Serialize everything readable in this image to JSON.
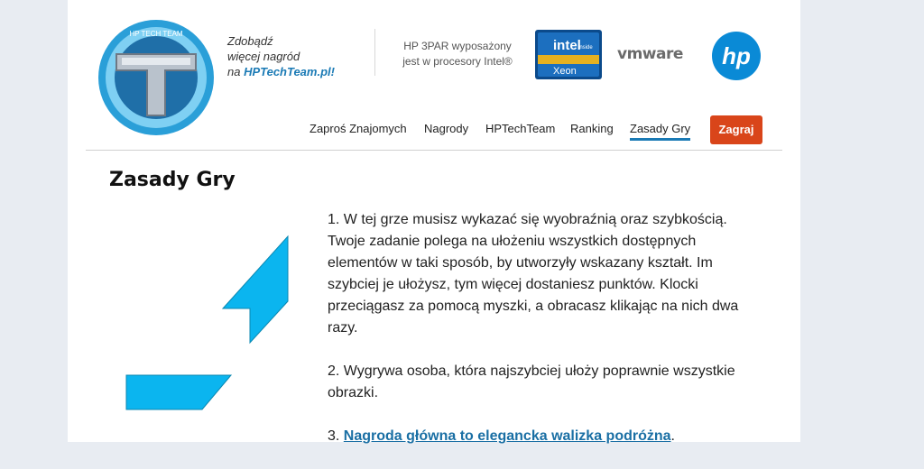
{
  "promo": {
    "line1": "Zdobądź",
    "line2": "więcej nagród",
    "line3_prefix": "na ",
    "site": "HPTechTeam.pl!"
  },
  "partner": {
    "line1": "HP 3PAR wyposażony",
    "line2": "jest w procesory Intel®",
    "intel_brand": "intel",
    "intel_inside": "inside",
    "intel_product": "Xeon",
    "vmware": "vmware",
    "hp": "hp"
  },
  "logo_text": "HP TECH TEAM",
  "nav": {
    "items": [
      {
        "label": "Zaproś Znajomych",
        "active": false
      },
      {
        "label": "Nagrody",
        "active": false
      },
      {
        "label": "HPTechTeam",
        "active": false
      },
      {
        "label": "Ranking",
        "active": false
      },
      {
        "label": "Zasady Gry",
        "active": true
      }
    ],
    "cta": "Zagraj"
  },
  "page": {
    "title": "Zasady Gry",
    "rule1": "1. W tej grze musisz wykazać się wyobraźnią oraz szybkością. Twoje zadanie polega na ułożeniu wszystkich dostępnych elementów w taki sposób, by utworzyły wskazany kształt. Im szybciej je ułożysz, tym więcej dostaniesz punktów. Klocki przeciągasz za pomocą myszki, a obracasz klikając na nich dwa razy.",
    "rule2": "2. Wygrywa osoba, która najszybciej ułoży poprawnie wszystkie obrazki.",
    "rule3_prefix": "3. ",
    "rule3_link": "Nagroda główna to elegancka walizka podróżna",
    "rule3_suffix": "."
  },
  "colors": {
    "accent": "#1a7ab5",
    "cta": "#d9451a",
    "shape": "#0bb5ef"
  }
}
